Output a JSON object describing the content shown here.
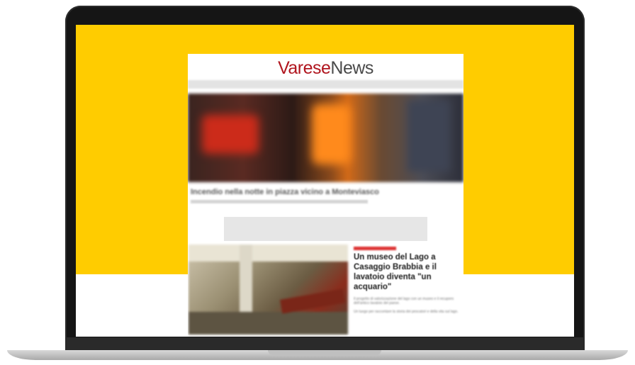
{
  "site": {
    "logo_part1": "Varese",
    "logo_part2": "News"
  },
  "hero": {
    "caption": "Incendio nella notte in piazza vicino a Monteviasco"
  },
  "article": {
    "title": "Un museo del Lago a Casaggio Brabbia e il lavatoio diventa \"un acquario\"",
    "summary": "Il progetto di valorizzazione del lago con un museo e il recupero dell'antico lavatoio del paese.",
    "summary2": "Un luogo per raccontare la storia dei pescatori e della vita sul lago."
  },
  "colors": {
    "background_band": "#ffcc00",
    "logo_accent": "#b0151e"
  }
}
